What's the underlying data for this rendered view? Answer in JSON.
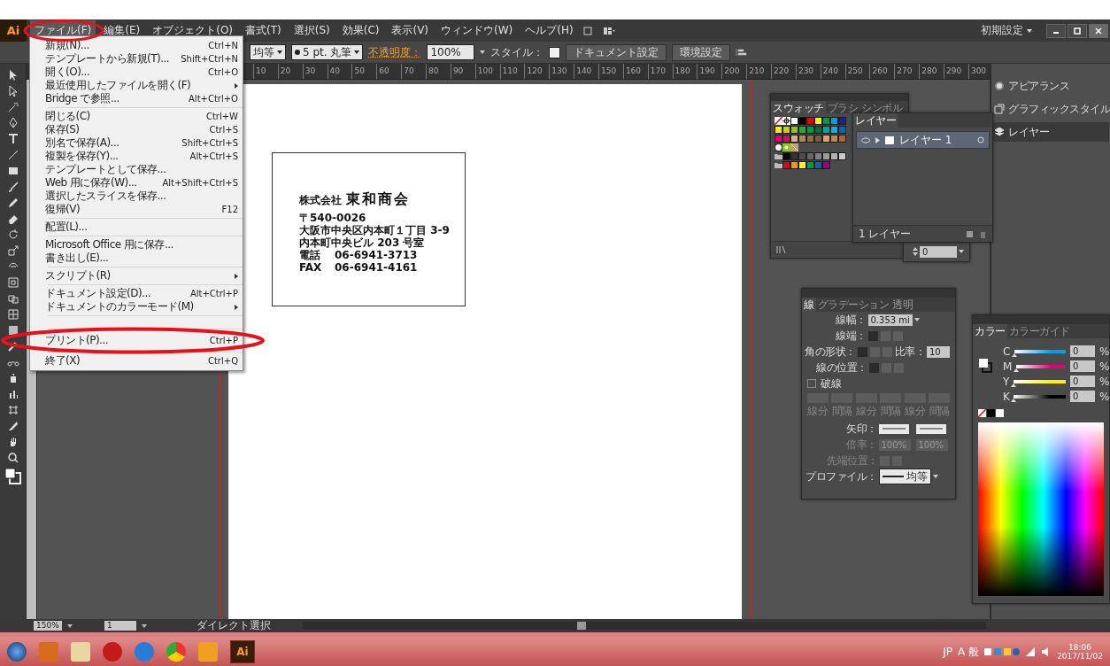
{
  "app": {
    "logo": "Ai",
    "workspace": "初期設定"
  },
  "menu_bar": [
    {
      "label": "ファイル(F)",
      "selected": true
    },
    {
      "label": "編集(E)",
      "selected": false
    },
    {
      "label": "オブジェクト(O)",
      "selected": false
    },
    {
      "label": "書式(T)",
      "selected": false
    },
    {
      "label": "選択(S)",
      "selected": false
    },
    {
      "label": "効果(C)",
      "selected": false
    },
    {
      "label": "表示(V)",
      "selected": false
    },
    {
      "label": "ウィンドウ(W)",
      "selected": false
    },
    {
      "label": "ヘルプ(H)",
      "selected": false
    }
  ],
  "control_bar": {
    "profile": "均等",
    "brush": "5 pt. 丸筆",
    "opacity_label": "不透明度：",
    "opacity": "100%",
    "style_label": "スタイル：",
    "buttons": [
      "ドキュメント設定",
      "環境設定"
    ]
  },
  "file_menu": {
    "groups": [
      [
        {
          "label": "新規(N)...",
          "shortcut": "Ctrl+N",
          "submenu": false
        },
        {
          "label": "テンプレートから新規(T)...",
          "shortcut": "Shift+Ctrl+N",
          "submenu": false
        },
        {
          "label": "開く(O)...",
          "shortcut": "Ctrl+O",
          "submenu": false
        },
        {
          "label": "最近使用したファイルを開く(F)",
          "submenu": true
        },
        {
          "label": "Bridge で参照...",
          "shortcut": "Alt+Ctrl+O",
          "submenu": false
        }
      ],
      [
        {
          "label": "閉じる(C)",
          "shortcut": "Ctrl+W",
          "submenu": false
        },
        {
          "label": "保存(S)",
          "shortcut": "Ctrl+S",
          "submenu": false
        },
        {
          "label": "別名で保存(A)...",
          "shortcut": "Shift+Ctrl+S",
          "submenu": false
        },
        {
          "label": "複製を保存(Y)...",
          "shortcut": "Alt+Ctrl+S",
          "submenu": false
        },
        {
          "label": "テンプレートとして保存...",
          "submenu": false
        },
        {
          "label": "Web 用に保存(W)...",
          "shortcut": "Alt+Shift+Ctrl+S",
          "submenu": false
        },
        {
          "label": "選択したスライスを保存...",
          "submenu": false
        },
        {
          "label": "復帰(V)",
          "shortcut": "F12",
          "submenu": false
        }
      ],
      [
        {
          "label": "配置(L)...",
          "submenu": false
        }
      ],
      [
        {
          "label": "Microsoft Office 用に保存...",
          "submenu": false
        },
        {
          "label": "書き出し(E)...",
          "submenu": false
        }
      ],
      [
        {
          "label": "スクリプト(R)",
          "submenu": true
        }
      ],
      [
        {
          "label": "ドキュメント設定(D)...",
          "shortcut": "Alt+Ctrl+P",
          "submenu": false
        },
        {
          "label": "ドキュメントのカラーモード(M)",
          "submenu": true
        }
      ],
      [
        {
          "label": "プリント(P)...",
          "shortcut": "Ctrl+P",
          "submenu": false
        }
      ],
      [
        {
          "label": "終了(X)",
          "shortcut": "Ctrl+Q",
          "submenu": false
        }
      ]
    ]
  },
  "ruler": {
    "ticks": [
      "10",
      "20",
      "30",
      "40",
      "50",
      "60",
      "70",
      "80",
      "90",
      "100",
      "110",
      "120",
      "130",
      "140",
      "150",
      "160",
      "170",
      "180",
      "190",
      "200",
      "210",
      "220",
      "230",
      "240",
      "250",
      "260",
      "270",
      "280",
      "290",
      "300"
    ]
  },
  "business_card": {
    "company_prefix": "株式会社",
    "company_name": "東和商会",
    "address_lines": [
      "〒540-0026",
      "大阪市中央区内本町１丁目 3-9",
      "内本町中央ビル 203 号室"
    ],
    "contacts": [
      {
        "label": "電話",
        "value": "06-6941-3713"
      },
      {
        "label": "FAX",
        "value": "06-6941-4161"
      }
    ]
  },
  "swatches_panel": {
    "tabs": [
      {
        "label": "スウォッチ",
        "selected": true
      },
      {
        "label": "ブラシ",
        "selected": false
      },
      {
        "label": "シンボル",
        "selected": false
      }
    ],
    "rows": [
      {
        "kind": "special",
        "swatches": [
          {
            "color": "#ffffff"
          },
          {
            "color": "#000000"
          },
          {
            "color": "#e60012"
          },
          {
            "color": "#fff100"
          },
          {
            "color": "#009944"
          },
          {
            "color": "#00a0e9"
          },
          {
            "color": "#1d2088"
          }
        ]
      },
      {
        "kind": "plain",
        "swatches": [
          {
            "color": "#fff100"
          },
          {
            "color": "#c9d200"
          },
          {
            "color": "#8fc31f"
          },
          {
            "color": "#22ac38"
          },
          {
            "color": "#009944"
          },
          {
            "color": "#007130"
          },
          {
            "color": "#00a29a"
          },
          {
            "color": "#00b7ee"
          },
          {
            "color": "#0068b7"
          }
        ]
      },
      {
        "kind": "plain",
        "swatches": [
          {
            "color": "#e4007f"
          },
          {
            "color": "#e5006a"
          },
          {
            "color": "#d3b28f"
          },
          {
            "color": "#b28850"
          },
          {
            "color": "#8f6e45"
          },
          {
            "color": "#7a5a3a"
          },
          {
            "color": "#d9a962"
          },
          {
            "color": "#c08a3e"
          },
          {
            "color": "#a6692d"
          }
        ]
      },
      {
        "kind": "pattern"
      },
      {
        "kind": "group",
        "swatches": [
          {
            "color": "#000000"
          },
          {
            "color": "#333333"
          },
          {
            "color": "#4d4d4d"
          },
          {
            "color": "#666666"
          },
          {
            "color": "#808080"
          },
          {
            "color": "#999999"
          },
          {
            "color": "#b3b3b3"
          },
          {
            "color": "#cccccc"
          }
        ]
      },
      {
        "kind": "group",
        "swatches": [
          {
            "color": "#e60012"
          },
          {
            "color": "#f39800"
          },
          {
            "color": "#fff100"
          },
          {
            "color": "#009944"
          },
          {
            "color": "#0068b7"
          },
          {
            "color": "#920783"
          }
        ]
      }
    ]
  },
  "layers_panel": {
    "tab": "レイヤー",
    "layers": [
      {
        "name": "レイヤー 1",
        "visible": true,
        "selected": true
      }
    ],
    "count": "1 レイヤー"
  },
  "hidden_panel": {
    "value": "0"
  },
  "dock": {
    "items": [
      {
        "label": "アピアランス",
        "selected": false
      },
      {
        "label": "グラフィックスタイル",
        "selected": false
      },
      {
        "label": "レイヤー",
        "selected": true
      }
    ]
  },
  "stroke_panel": {
    "tabs": [
      {
        "label": "線",
        "selected": true
      },
      {
        "label": "グラデーション",
        "selected": false
      },
      {
        "label": "透明",
        "selected": false
      }
    ],
    "weight_label": "線幅：",
    "weight": "0.353 mi",
    "cap_label": "線端：",
    "cap_options": [
      {
        "selected": true
      },
      {
        "selected": false
      },
      {
        "selected": false
      }
    ],
    "corner_label": "角の形状：",
    "corner_options": [
      {
        "selected": true
      },
      {
        "selected": false
      },
      {
        "selected": false
      }
    ],
    "limit_label": "比率：",
    "limit": "10",
    "align_label": "線の位置：",
    "align_options": [
      {
        "selected": true
      },
      {
        "selected": false
      },
      {
        "selected": false
      }
    ],
    "dashed": {
      "label": "破線",
      "checked": false
    },
    "dash_fields": [
      "線分",
      "間隔",
      "線分",
      "間隔",
      "線分",
      "間隔"
    ],
    "arrow_label": "矢印：",
    "scale_label": "倍率：",
    "scale_values": [
      "100%",
      "100%"
    ],
    "tip_label": "先端位置：",
    "profile_label": "プロファイル：",
    "profile": "均等"
  },
  "color_panel": {
    "tabs": [
      {
        "label": "カラー",
        "selected": true
      },
      {
        "label": "カラーガイド",
        "selected": false
      }
    ],
    "channels": [
      {
        "name": "C",
        "level": 0,
        "value": "0",
        "unit": "%",
        "color": "#00a0e9"
      },
      {
        "name": "M",
        "level": 0,
        "value": "0",
        "unit": "%",
        "color": "#e4007f"
      },
      {
        "name": "Y",
        "level": 0,
        "value": "0",
        "unit": "%",
        "color": "#fff100"
      },
      {
        "name": "K",
        "level": 0,
        "value": "0",
        "unit": "%",
        "color": "#000000"
      }
    ]
  },
  "status_bar": {
    "zoom": "150%",
    "page": "1",
    "tool": "ダイレクト選択"
  },
  "taskbar": {
    "active_app": "Ai",
    "tray": [
      "JP",
      "A 般"
    ],
    "time": "18:06",
    "date": "2017/11/02"
  }
}
